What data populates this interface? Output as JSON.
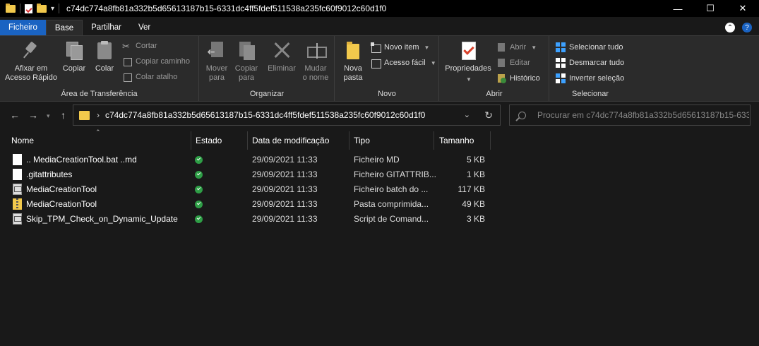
{
  "window": {
    "title": "c74dc774a8fb81a332b5d65613187b15-6331dc4ff5fdef511538a235fc60f9012c60d1f0",
    "controls": {
      "minimize": "—",
      "maximize": "☐",
      "close": "✕"
    }
  },
  "quick_access": {
    "dropdown": "▾",
    "pipe": "|"
  },
  "tabs": [
    {
      "label": "Ficheiro"
    },
    {
      "label": "Base"
    },
    {
      "label": "Partilhar"
    },
    {
      "label": "Ver"
    }
  ],
  "ribbon": {
    "clipboard": {
      "label": "Área de Transferência",
      "pin": "Afixar em\nAcesso Rápido",
      "copy": "Copiar",
      "paste": "Colar",
      "cut": "Cortar",
      "copy_path": "Copiar caminho",
      "paste_shortcut": "Colar atalho"
    },
    "organize": {
      "label": "Organizar",
      "move_to": "Mover\npara",
      "copy_to": "Copiar\npara",
      "delete": "Eliminar",
      "rename": "Mudar\no nome"
    },
    "new": {
      "label": "Novo",
      "new_folder": "Nova\npasta",
      "new_item": "Novo item",
      "easy_access": "Acesso fácil"
    },
    "open": {
      "label": "Abrir",
      "properties": "Propriedades",
      "open": "Abrir",
      "edit": "Editar",
      "history": "Histórico"
    },
    "select": {
      "label": "Selecionar",
      "select_all": "Selecionar tudo",
      "select_none": "Desmarcar tudo",
      "invert": "Inverter seleção"
    }
  },
  "nav": {
    "path": "c74dc774a8fb81a332b5d65613187b15-6331dc4ff5fdef511538a235fc60f9012c60d1f0",
    "search_placeholder": "Procurar em c74dc774a8fb81a332b5d65613187b15-633..."
  },
  "columns": {
    "name": "Nome",
    "status": "Estado",
    "modified": "Data de modificação",
    "type": "Tipo",
    "size": "Tamanho"
  },
  "files": [
    {
      "name": ".. MediaCreationTool.bat ..md",
      "icon": "document-icon",
      "modified": "29/09/2021 11:33",
      "type": "Ficheiro MD",
      "size": "5 KB"
    },
    {
      "name": ".gitattributes",
      "icon": "document-icon",
      "modified": "29/09/2021 11:33",
      "type": "Ficheiro GITATTRIB...",
      "size": "1 KB"
    },
    {
      "name": "MediaCreationTool",
      "icon": "batch-file-icon",
      "modified": "29/09/2021 11:33",
      "type": "Ficheiro batch do ...",
      "size": "117 KB"
    },
    {
      "name": "MediaCreationTool",
      "icon": "zip-folder-icon",
      "modified": "29/09/2021 11:33",
      "type": "Pasta comprimida...",
      "size": "49 KB"
    },
    {
      "name": "Skip_TPM_Check_on_Dynamic_Update",
      "icon": "cmd-script-icon",
      "modified": "29/09/2021 11:33",
      "type": "Script de Comand...",
      "size": "3 KB"
    }
  ]
}
